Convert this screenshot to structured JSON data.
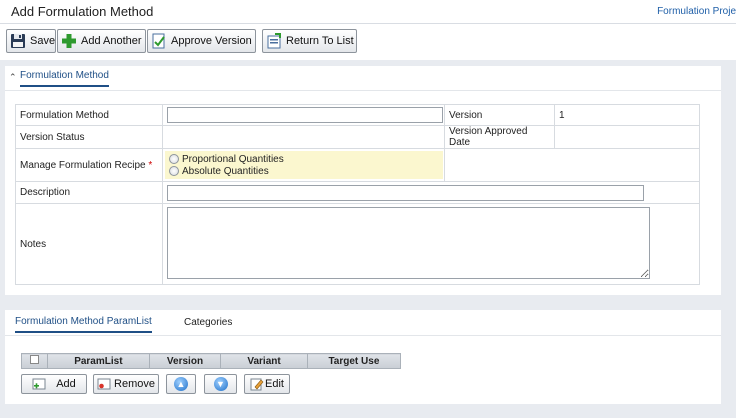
{
  "header": {
    "title": "Add Formulation Method",
    "project_link": "Formulation Proje"
  },
  "toolbar": {
    "save": "Save",
    "add_another": "Add Another",
    "approve_version": "Approve Version",
    "return_to_list": "Return To List"
  },
  "section1": {
    "tab": "Formulation Method",
    "fields": {
      "method_label": "Formulation Method",
      "method_value": "",
      "version_label": "Version",
      "version_value": "1",
      "status_label": "Version Status",
      "approved_date_label": "Version Approved Date",
      "recipe_label": "Manage Formulation Recipe",
      "required_mark": "*",
      "recipe_options": [
        "Proportional Quantities",
        "Absolute Quantities"
      ],
      "description_label": "Description",
      "description_value": "",
      "notes_label": "Notes",
      "notes_value": ""
    }
  },
  "section2": {
    "tabs": [
      "Formulation Method ParamList",
      "Categories"
    ],
    "grid_columns": [
      "ParamList",
      "Version",
      "Variant",
      "Target Use"
    ],
    "buttons": {
      "add": "Add",
      "remove": "Remove",
      "edit": "Edit"
    }
  },
  "colors": {
    "accent": "#1f4f86",
    "link": "#1f5fa8",
    "required_bg": "#fbf7cf",
    "background": "#e8ebf0"
  },
  "icons": {
    "save": "floppy-disk-icon",
    "add_another": "green-plus-icon",
    "approve": "approve-document-icon",
    "return": "return-list-icon",
    "up": "move-up-icon",
    "down": "move-down-icon",
    "edit": "edit-pencil-icon"
  }
}
